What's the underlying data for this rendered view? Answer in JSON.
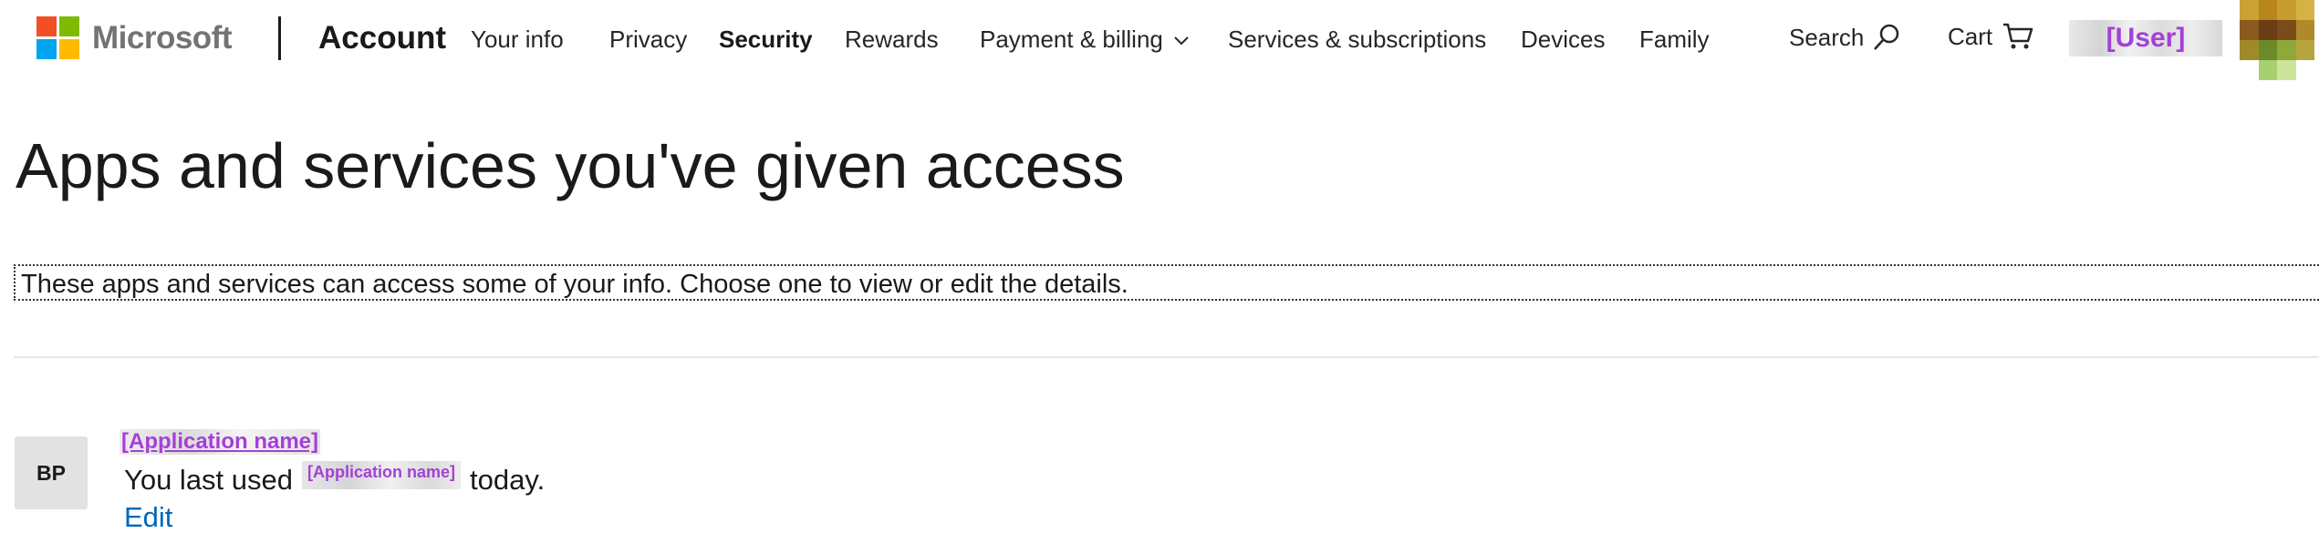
{
  "header": {
    "brand": "Microsoft",
    "section_title": "Account",
    "nav": [
      {
        "label": "Your info"
      },
      {
        "label": "Privacy"
      },
      {
        "label": "Security"
      },
      {
        "label": "Rewards"
      },
      {
        "label": "Payment & billing"
      },
      {
        "label": "Services & subscriptions"
      },
      {
        "label": "Devices"
      },
      {
        "label": "Family"
      }
    ],
    "active_nav": "Security",
    "search_label": "Search",
    "cart_label": "Cart",
    "user_name": "[User]"
  },
  "colors": {
    "logo_red": "#f25022",
    "logo_green": "#7fba00",
    "logo_blue": "#00a4ef",
    "logo_yellow": "#ffb900",
    "link": "#0067b8",
    "redaction_label": "#a340d8"
  },
  "main": {
    "title": "Apps and services you've given access",
    "intro": "These apps and services can access some of your info. Choose one to view or edit the details.",
    "apps": [
      {
        "initials": "BP",
        "name": "[Application name]",
        "last_used_prefix": "You last used",
        "last_used_app": "[Application name]",
        "last_used_suffix": "today.",
        "edit_label": "Edit"
      }
    ]
  }
}
